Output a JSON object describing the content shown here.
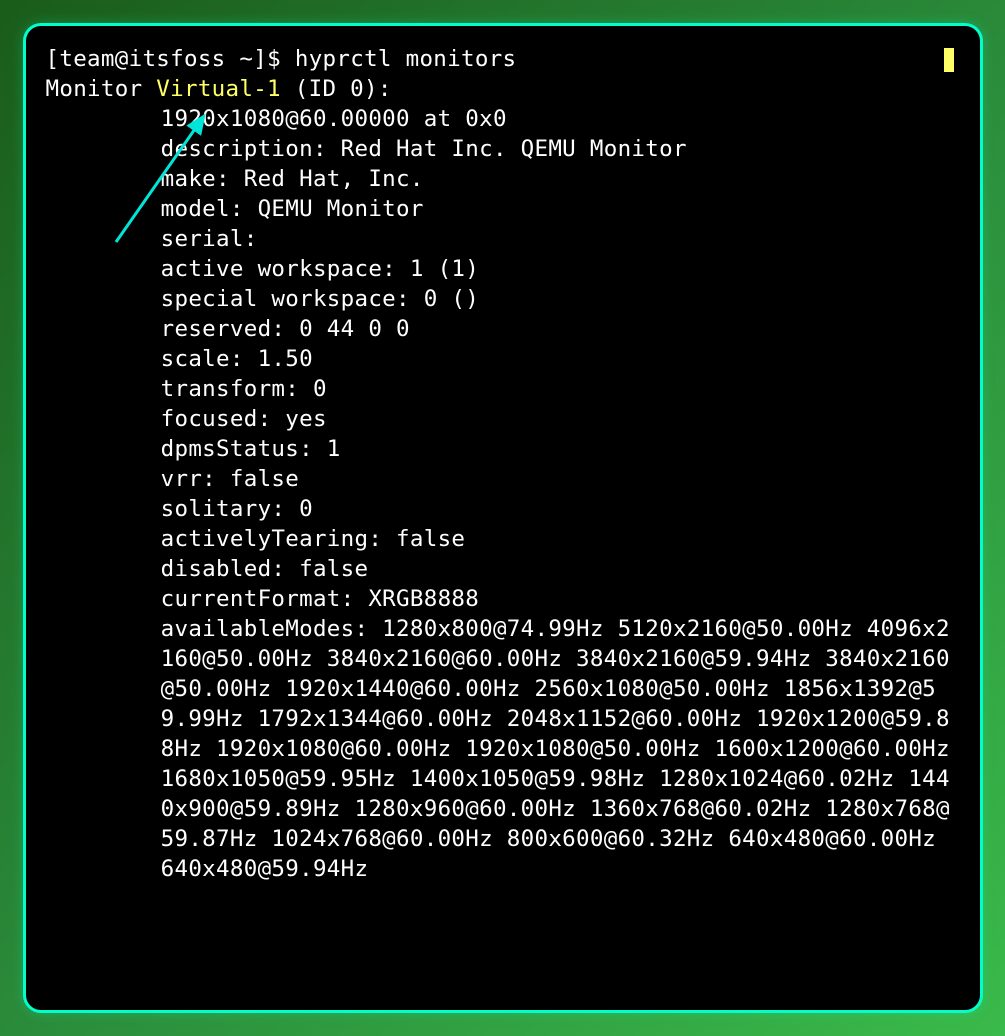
{
  "prompt": {
    "user": "team",
    "host": "itsfoss",
    "dir": "~",
    "symbol": "$",
    "command": "hyprctl monitors"
  },
  "monitor": {
    "prefix": "Monitor ",
    "name": "Virtual-1",
    "id_suffix": " (ID 0):",
    "resolution_line": "1920x1080@60.00000 at 0x0",
    "description": "description: Red Hat Inc. QEMU Monitor",
    "make": "make: Red Hat, Inc.",
    "model": "model: QEMU Monitor",
    "serial": "serial:",
    "active_workspace": "active workspace: 1 (1)",
    "special_workspace": "special workspace: 0 ()",
    "reserved": "reserved: 0 44 0 0",
    "scale": "scale: 1.50",
    "transform": "transform: 0",
    "focused": "focused: yes",
    "dpmsStatus": "dpmsStatus: 1",
    "vrr": "vrr: false",
    "solitary": "solitary: 0",
    "activelyTearing": "activelyTearing: false",
    "disabled": "disabled: false",
    "currentFormat": "currentFormat: XRGB8888",
    "availableModes": "availableModes: 1280x800@74.99Hz 5120x2160@50.00Hz 4096x2160@50.00Hz 3840x2160@60.00Hz 3840x2160@59.94Hz 3840x2160@50.00Hz 1920x1440@60.00Hz 2560x1080@50.00Hz 1856x1392@59.99Hz 1792x1344@60.00Hz 2048x1152@60.00Hz 1920x1200@59.88Hz 1920x1080@60.00Hz 1920x1080@50.00Hz 1600x1200@60.00Hz 1680x1050@59.95Hz 1400x1050@59.98Hz 1280x1024@60.02Hz 1440x900@59.89Hz 1280x960@60.00Hz 1360x768@60.02Hz 1280x768@59.87Hz 1024x768@60.00Hz 800x600@60.32Hz 640x480@60.00Hz 640x480@59.94Hz"
  },
  "colors": {
    "highlight": "#ffff66",
    "text": "#ffffff",
    "border": "#00ffcc",
    "arrow": "#00e5d8"
  }
}
